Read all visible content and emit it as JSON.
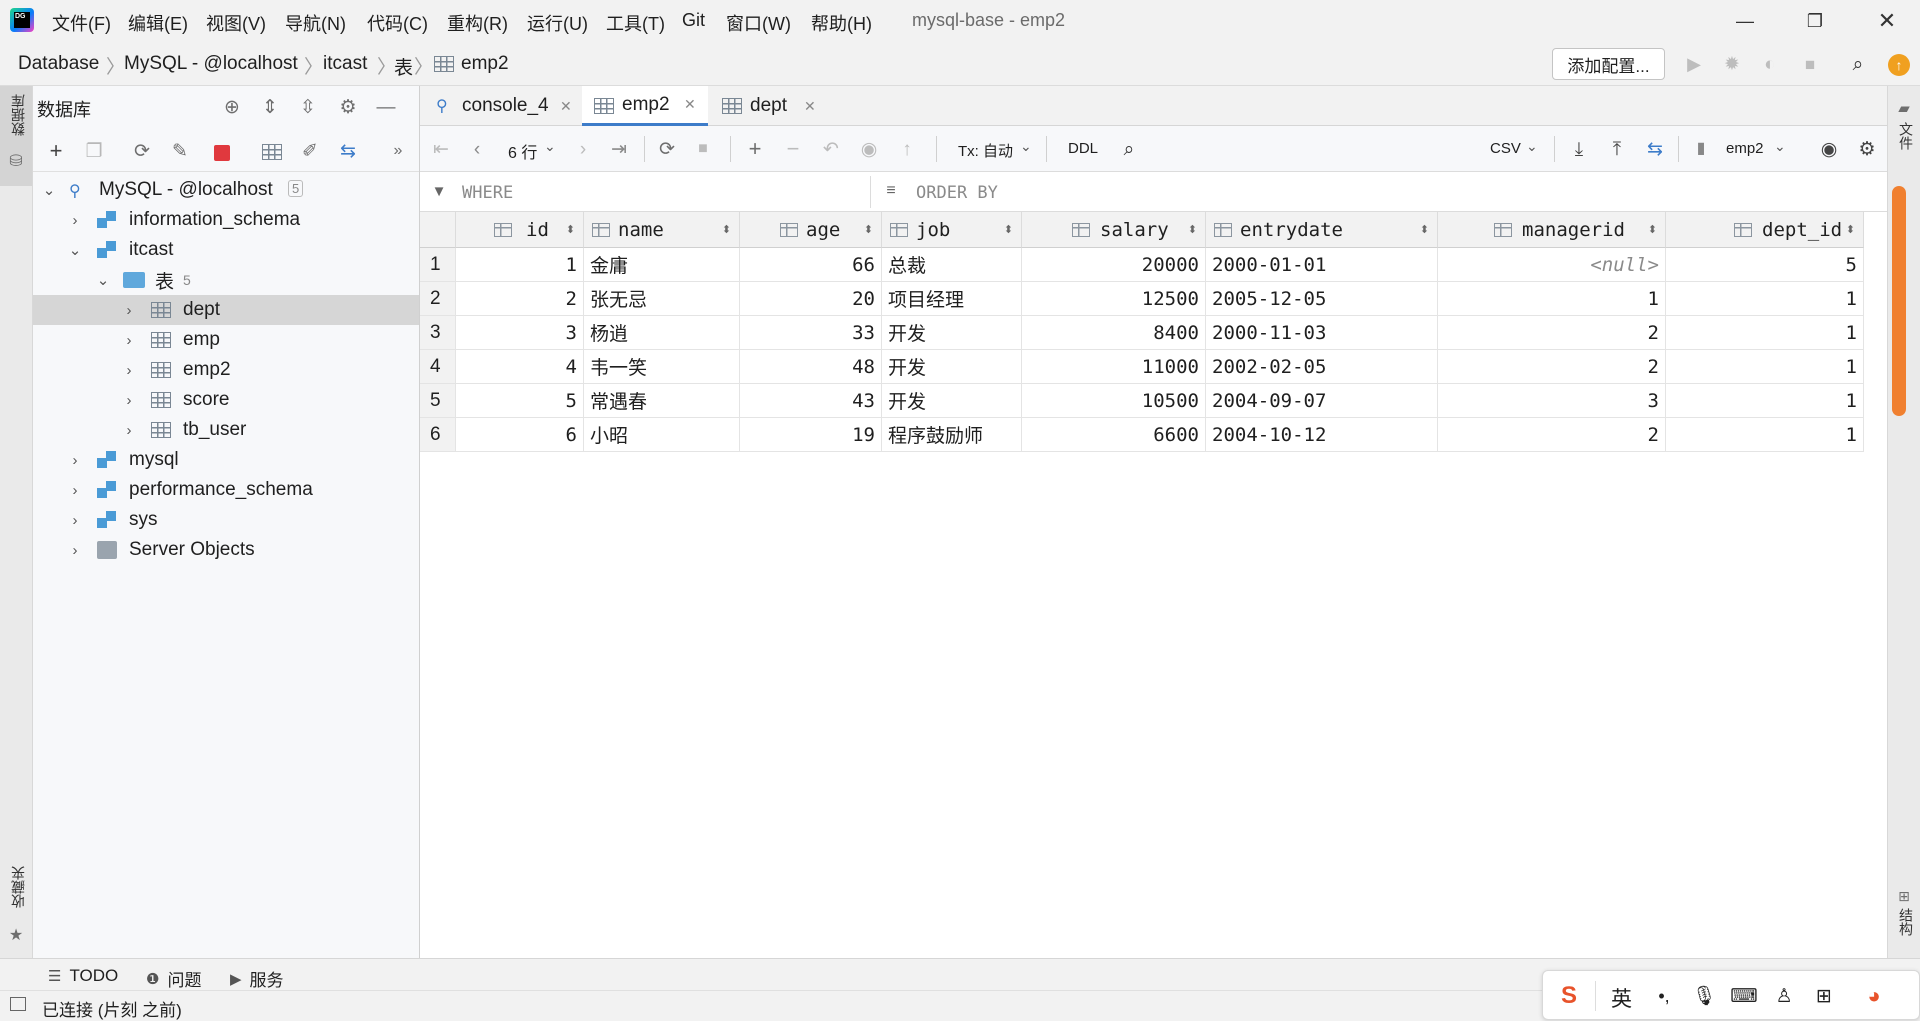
{
  "menubar": {
    "items": [
      "文件(F)",
      "编辑(E)",
      "视图(V)",
      "导航(N)",
      "代码(C)",
      "重构(R)",
      "运行(U)",
      "工具(T)",
      "Git",
      "窗口(W)",
      "帮助(H)"
    ],
    "title": "mysql-base - emp2"
  },
  "breadcrumb": [
    "Database",
    "MySQL - @localhost",
    "itcast",
    "表",
    "emp2"
  ],
  "run_config_label": "添加配置...",
  "db_panel": {
    "title": "数据库",
    "tree": {
      "connection": "MySQL - @localhost",
      "connection_count": "5",
      "schemas_top": [
        "information_schema",
        "itcast"
      ],
      "tables_folder": "表",
      "tables_count": "5",
      "tables": [
        "dept",
        "emp",
        "emp2",
        "score",
        "tb_user"
      ],
      "schemas_bottom": [
        "mysql",
        "performance_schema",
        "sys"
      ],
      "server_objects": "Server Objects"
    }
  },
  "left_strip": {
    "database_label": "数据库",
    "favorites_label": "收藏夹"
  },
  "right_strip": {
    "top_label": "文件",
    "bottom_label": "结构"
  },
  "tabs": [
    "console_4",
    "emp2",
    "dept"
  ],
  "data_toolbar": {
    "rows_label": "6 行",
    "tx_label": "Tx: 自动",
    "ddl_label": "DDL",
    "export_format": "CSV",
    "target": "emp2"
  },
  "filter": {
    "where_label": "WHERE",
    "order_label": "ORDER BY"
  },
  "table": {
    "columns": [
      "id",
      "name",
      "age",
      "job",
      "salary",
      "entrydate",
      "managerid",
      "dept_id"
    ],
    "rows": [
      [
        "1",
        "1",
        "金庸",
        "66",
        "总裁",
        "20000",
        "2000-01-01",
        "<null>",
        "5"
      ],
      [
        "2",
        "2",
        "张无忌",
        "20",
        "项目经理",
        "12500",
        "2005-12-05",
        "1",
        "1"
      ],
      [
        "3",
        "3",
        "杨逍",
        "33",
        "开发",
        "8400",
        "2000-11-03",
        "2",
        "1"
      ],
      [
        "4",
        "4",
        "韦一笑",
        "48",
        "开发",
        "11000",
        "2002-02-05",
        "2",
        "1"
      ],
      [
        "5",
        "5",
        "常遇春",
        "43",
        "开发",
        "10500",
        "2004-09-07",
        "3",
        "1"
      ],
      [
        "6",
        "6",
        "小昭",
        "19",
        "程序鼓励师",
        "6600",
        "2004-10-12",
        "2",
        "1"
      ]
    ]
  },
  "bottom_tools": [
    "TODO",
    "问题",
    "服务"
  ],
  "status_text": "已连接 (片刻 之前)",
  "ime": {
    "lang": "英"
  },
  "colors": {
    "accent": "#3d7cc9",
    "stop": "#e0393e",
    "schema": "#4a9bd6",
    "update_badge": "#f0a020"
  }
}
